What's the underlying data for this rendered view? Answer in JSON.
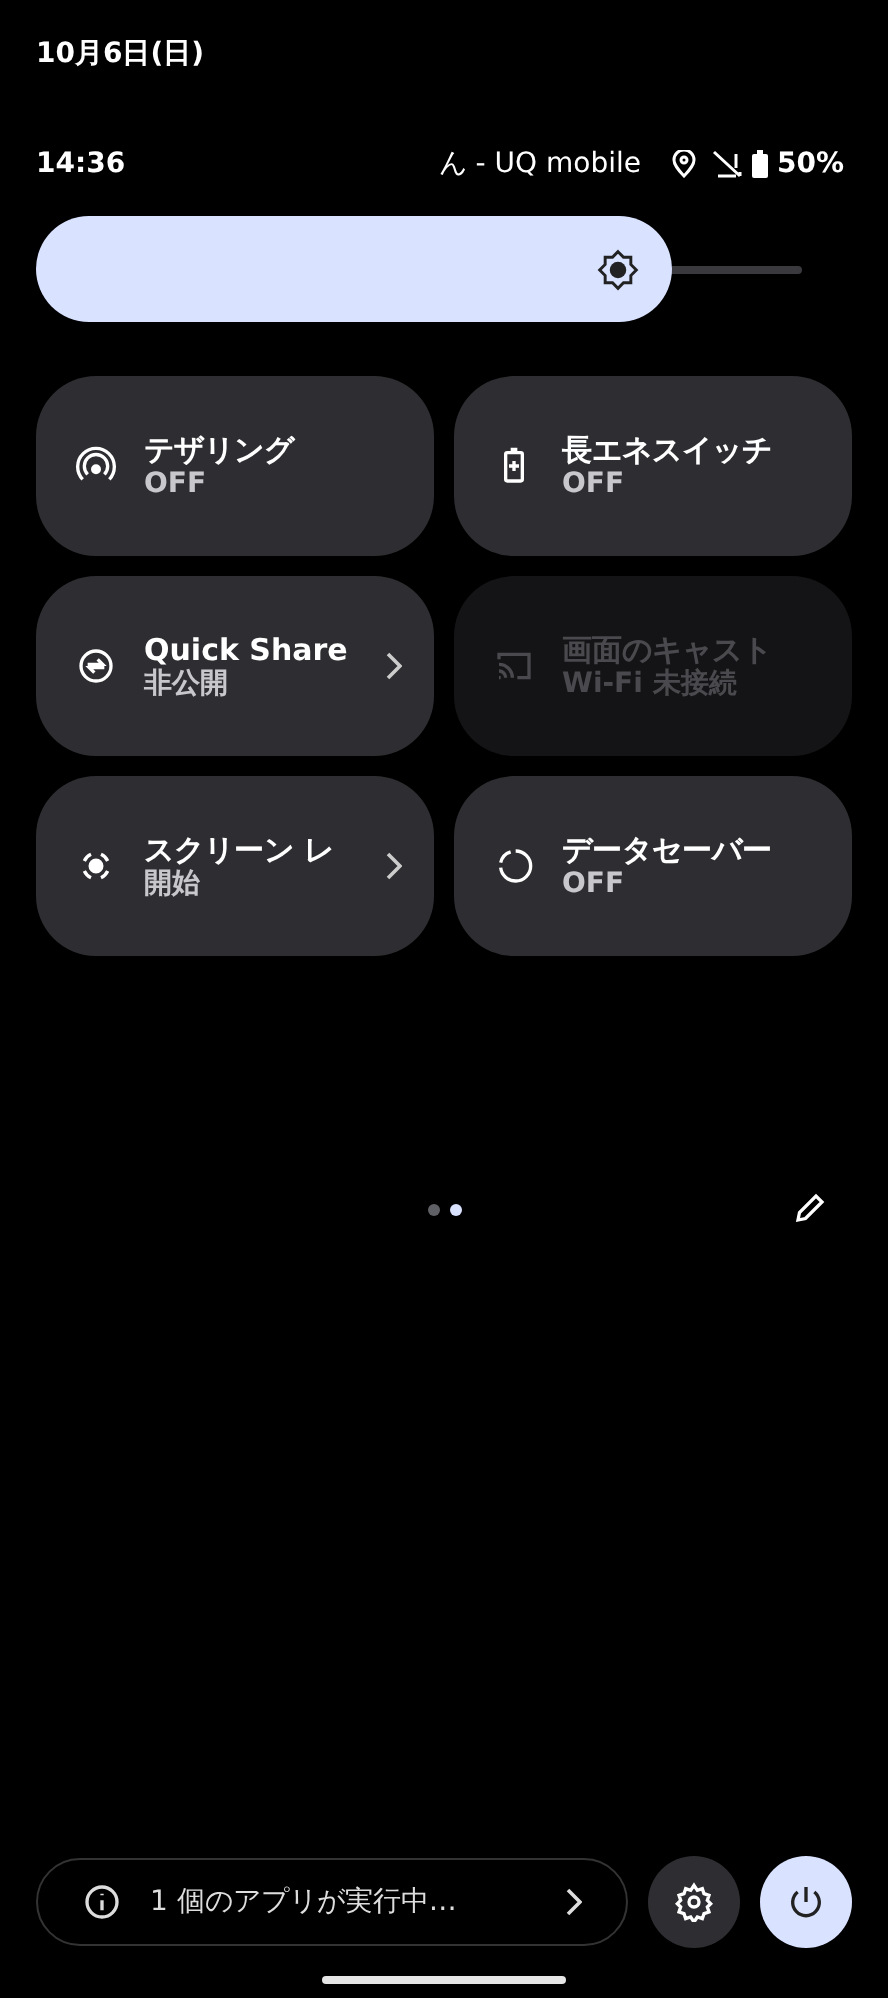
{
  "header": {
    "date": "10月6日(日)",
    "time": "14:36",
    "carrier": "ん - UQ mobile",
    "battery": "50%"
  },
  "brightness": {
    "level": 0.83
  },
  "tiles": [
    {
      "title": "テザリング",
      "subtitle": "OFF",
      "chevron": false,
      "disabled": false
    },
    {
      "title": "長エネスイッチ",
      "subtitle": "OFF",
      "chevron": false,
      "disabled": false
    },
    {
      "title": "Quick Share",
      "subtitle": "非公開",
      "chevron": true,
      "disabled": false
    },
    {
      "title": "画面のキャスト",
      "subtitle": "Wi-Fi 未接続",
      "chevron": false,
      "disabled": true
    },
    {
      "title": "スクリーン レ",
      "subtitle": "開始",
      "chevron": true,
      "disabled": false
    },
    {
      "title": "データセーバー",
      "subtitle": "OFF",
      "chevron": false,
      "disabled": false
    }
  ],
  "pages": [
    {
      "selected": false
    },
    {
      "selected": true
    }
  ],
  "footer": {
    "running_apps": "1 個のアプリが実行中…"
  }
}
